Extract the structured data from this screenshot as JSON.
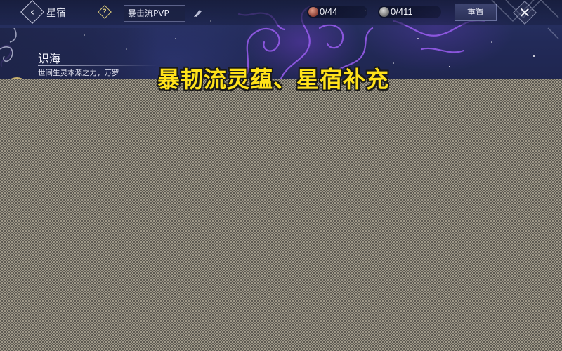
{
  "header": {
    "title": "星宿",
    "back_icon": "chevron-left-icon",
    "help_icon": "question-diamond-icon",
    "help_symbol": "?",
    "build_select": {
      "value": "暴击流PVP"
    },
    "edit_icon": "brush-icon",
    "resources": [
      {
        "icon": "red-star-orb-icon",
        "value": "0/44",
        "color": "#b85a4b"
      },
      {
        "icon": "silver-star-orb-icon",
        "value": "0/411",
        "color": "#9a9a9a"
      }
    ],
    "reset_label": "重置",
    "close_icon": "close-x-icon"
  },
  "info_panel": {
    "title": "识海",
    "description": "世间生灵本源之力，万罗星象根基所在",
    "emblem_icon": "gold-emblem-icon"
  },
  "overlay_caption": "暴韧流灵蕴、星宿补充",
  "colors": {
    "caption": "#ffe21a",
    "background": "#222a58",
    "accent_purple": "#8a4fe0"
  }
}
